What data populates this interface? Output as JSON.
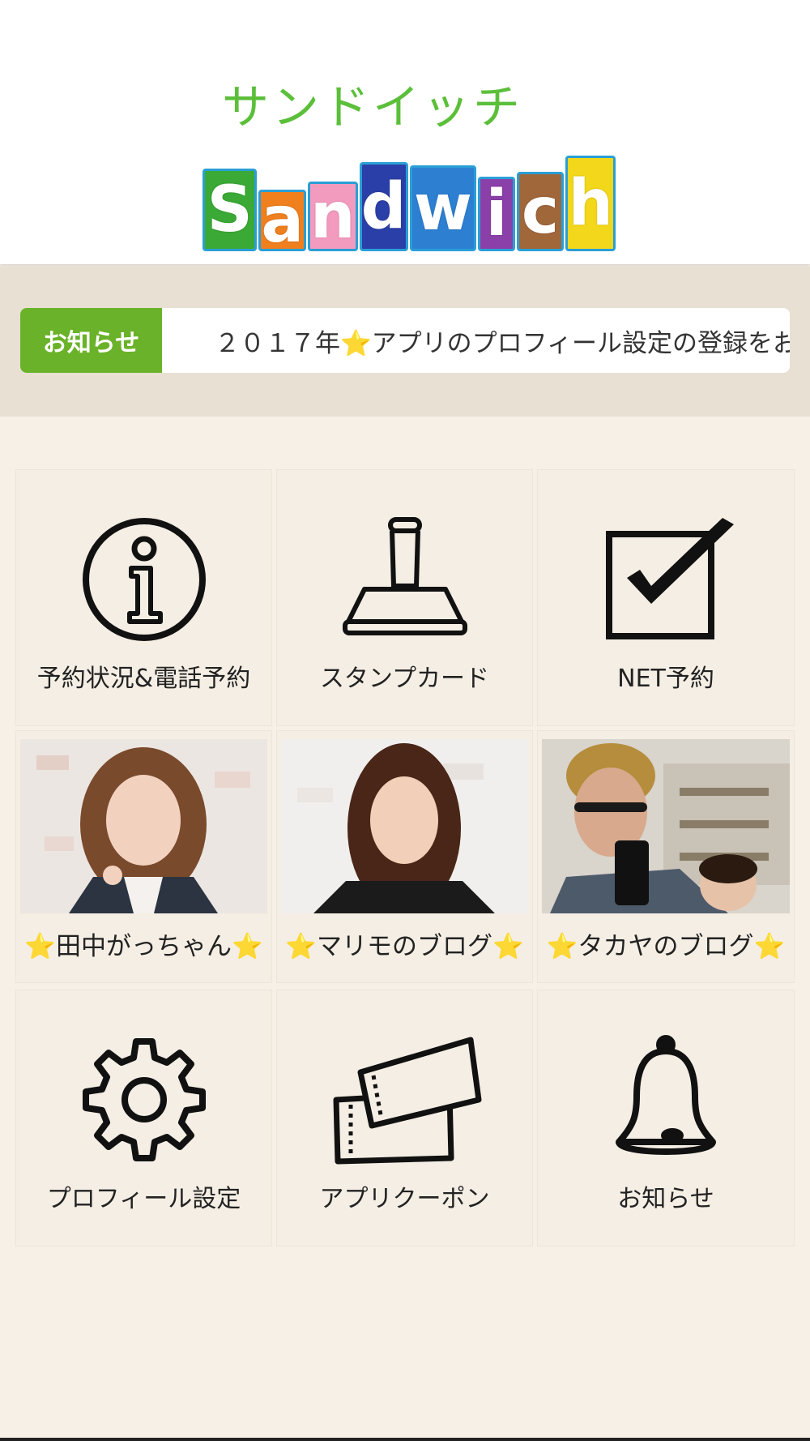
{
  "header": {
    "logo_kana": "サンドイッチ",
    "logo_word_letters": [
      "S",
      "a",
      "n",
      "d",
      "w",
      "i",
      "c",
      "h"
    ],
    "logo_word_colors": [
      "#3aa935",
      "#f07f1e",
      "#f39bbf",
      "#2b3fa8",
      "#2d7fd2",
      "#8b3fa8",
      "#a0673b",
      "#f3d71a"
    ]
  },
  "news": {
    "label": "お知らせ",
    "text": "２０１７年⭐️アプリのプロフィール設定の登録をお"
  },
  "menu": [
    {
      "label": "予約状況&電話予約",
      "icon": "info-icon"
    },
    {
      "label": "スタンプカード",
      "icon": "stamp-icon"
    },
    {
      "label": "NET予約",
      "icon": "checkbox-icon"
    },
    {
      "label": "⭐️田中がっちゃん⭐️",
      "icon": "staff-photo-1"
    },
    {
      "label": "⭐️マリモのブログ⭐️",
      "icon": "staff-photo-2"
    },
    {
      "label": "⭐️タカヤのブログ⭐️",
      "icon": "staff-photo-3"
    },
    {
      "label": "プロフィール設定",
      "icon": "gear-icon"
    },
    {
      "label": "アプリクーポン",
      "icon": "coupon-icon"
    },
    {
      "label": "お知らせ",
      "icon": "bell-icon"
    }
  ],
  "colors": {
    "accent_green": "#6ab229",
    "background": "#f6f0e6",
    "band": "#e7e0d3"
  }
}
